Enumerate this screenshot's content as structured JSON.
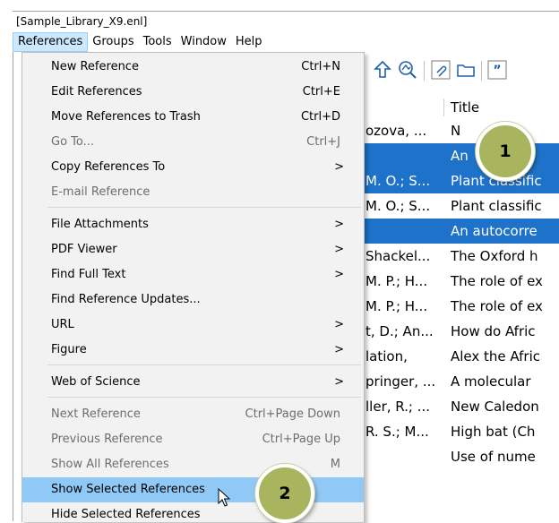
{
  "window": {
    "title": "[Sample_Library_X9.enl]"
  },
  "menubar": [
    "References",
    "Groups",
    "Tools",
    "Window",
    "Help"
  ],
  "references_menu": {
    "items": [
      {
        "label": "New Reference",
        "shortcut": "Ctrl+N"
      },
      {
        "label": "Edit References",
        "shortcut": "Ctrl+E"
      },
      {
        "label": "Move References to Trash",
        "shortcut": "Ctrl+D"
      },
      {
        "label": "Go To...",
        "shortcut": "Ctrl+J"
      },
      {
        "label": "Copy References To",
        "shortcut": ">"
      },
      {
        "label": "E-mail Reference",
        "shortcut": ""
      },
      {
        "label": "File Attachments",
        "shortcut": ">"
      },
      {
        "label": "PDF Viewer",
        "shortcut": ">"
      },
      {
        "label": "Find Full Text",
        "shortcut": ">"
      },
      {
        "label": "Find Reference Updates...",
        "shortcut": ""
      },
      {
        "label": "URL",
        "shortcut": ">"
      },
      {
        "label": "Figure",
        "shortcut": ">"
      },
      {
        "label": "Web of Science",
        "shortcut": ">"
      },
      {
        "label": "Next Reference",
        "shortcut": "Ctrl+Page Down"
      },
      {
        "label": "Previous Reference",
        "shortcut": "Ctrl+Page Up"
      },
      {
        "label": "Show All References",
        "shortcut": "M"
      },
      {
        "label": "Show Selected References",
        "shortcut": ""
      },
      {
        "label": "Hide Selected References",
        "shortcut": ""
      }
    ]
  },
  "library": {
    "title_column_header": "Title",
    "rows": [
      {
        "author": "ozova, ...",
        "title": "N"
      },
      {
        "author": "",
        "title": "An"
      },
      {
        "author": "M. O.; S...",
        "title": "Plant classific"
      },
      {
        "author": "M. O.; S...",
        "title": "Plant classific"
      },
      {
        "author": "",
        "title": "An autocorre"
      },
      {
        "author": "Shackel...",
        "title": "The Oxford h"
      },
      {
        "author": "M. P.; H...",
        "title": "The role of ex"
      },
      {
        "author": "M. P.; H...",
        "title": "The role of ex"
      },
      {
        "author": "t, D.; An...",
        "title": "How do Afric"
      },
      {
        "author": "lation,",
        "title": "Alex the Afric"
      },
      {
        "author": "pringer, ...",
        "title": "A molecular"
      },
      {
        "author": "ller, R.; ...",
        "title": "New Caledon"
      },
      {
        "author": "R. S.; M...",
        "title": "High bat (Ch"
      },
      {
        "author": "",
        "title": "Use of nume"
      }
    ]
  },
  "callouts": {
    "one": "1",
    "two": "2"
  },
  "colors": {
    "selection": "#1e72c9",
    "menu_highlight": "#90c8f6",
    "badge": "#a8b55e"
  }
}
